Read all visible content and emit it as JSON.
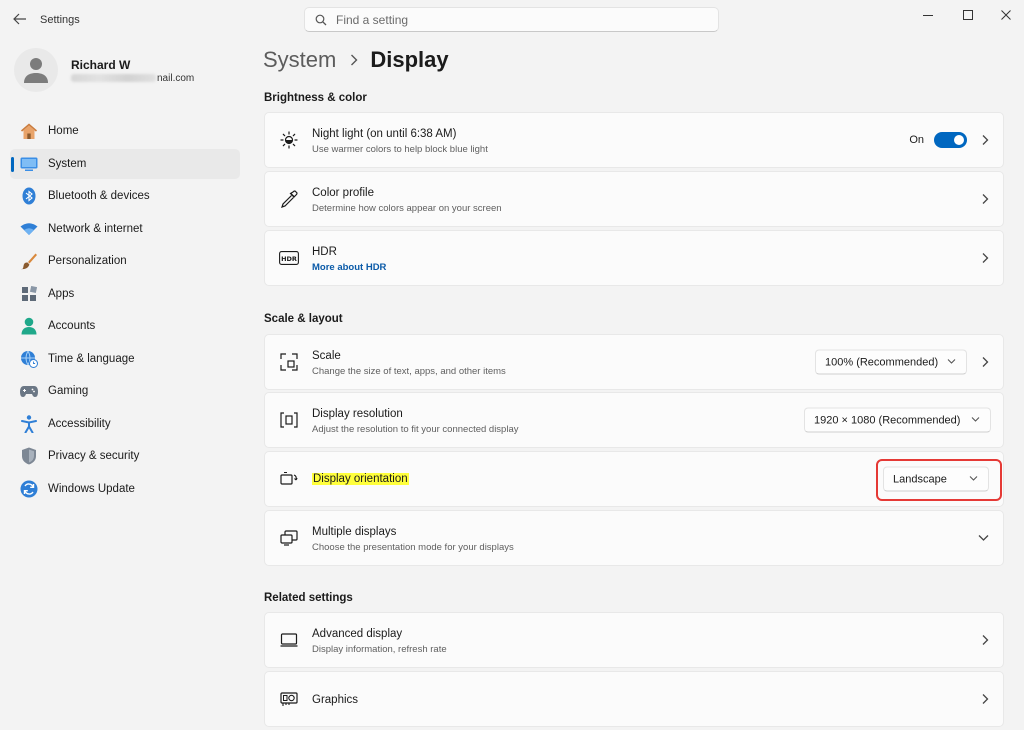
{
  "window": {
    "title": "Settings"
  },
  "search": {
    "placeholder": "Find a setting"
  },
  "user": {
    "name": "Richard W",
    "email_visible": "nail.com"
  },
  "sidebar": {
    "items": [
      {
        "label": "Home",
        "icon": "home-icon"
      },
      {
        "label": "System",
        "icon": "system-icon",
        "active": true
      },
      {
        "label": "Bluetooth & devices",
        "icon": "bluetooth-icon"
      },
      {
        "label": "Network & internet",
        "icon": "wifi-icon"
      },
      {
        "label": "Personalization",
        "icon": "brush-icon"
      },
      {
        "label": "Apps",
        "icon": "apps-icon"
      },
      {
        "label": "Accounts",
        "icon": "accounts-icon"
      },
      {
        "label": "Time & language",
        "icon": "globe-clock-icon"
      },
      {
        "label": "Gaming",
        "icon": "gamepad-icon"
      },
      {
        "label": "Accessibility",
        "icon": "accessibility-icon"
      },
      {
        "label": "Privacy & security",
        "icon": "shield-icon"
      },
      {
        "label": "Windows Update",
        "icon": "update-icon"
      }
    ]
  },
  "breadcrumb": {
    "parent": "System",
    "current": "Display"
  },
  "sections": {
    "brightness": {
      "title": "Brightness & color",
      "night_light": {
        "title": "Night light (on until 6:38 AM)",
        "subtitle": "Use warmer colors to help block blue light",
        "state_label": "On",
        "on": true
      },
      "color_profile": {
        "title": "Color profile",
        "subtitle": "Determine how colors appear on your screen"
      },
      "hdr": {
        "title": "HDR",
        "link": "More about HDR"
      }
    },
    "scale_layout": {
      "title": "Scale & layout",
      "scale": {
        "title": "Scale",
        "subtitle": "Change the size of text, apps, and other items",
        "value": "100% (Recommended)"
      },
      "resolution": {
        "title": "Display resolution",
        "subtitle": "Adjust the resolution to fit your connected display",
        "value": "1920 × 1080 (Recommended)"
      },
      "orientation": {
        "title": "Display orientation",
        "value": "Landscape"
      },
      "multiple": {
        "title": "Multiple displays",
        "subtitle": "Choose the presentation mode for your displays"
      }
    },
    "related": {
      "title": "Related settings",
      "advanced": {
        "title": "Advanced display",
        "subtitle": "Display information, refresh rate"
      },
      "graphics": {
        "title": "Graphics"
      }
    }
  },
  "colors": {
    "accent": "#0067c0",
    "highlight": "#ffff3c",
    "annotation": "#e53935"
  }
}
